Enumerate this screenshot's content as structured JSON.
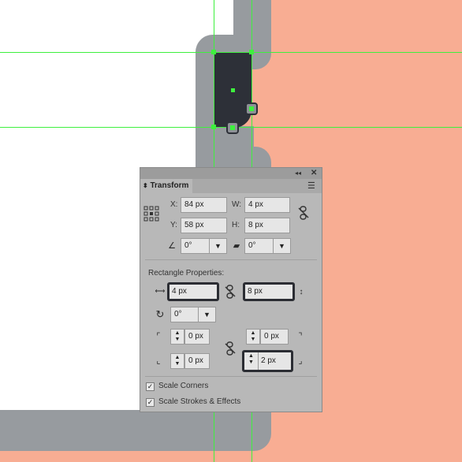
{
  "panel": {
    "title": "Transform",
    "collapse_icon": "double-chevron-left-icon",
    "close_icon": "close-icon",
    "menu_icon": "hamburger-menu-icon",
    "x_label": "X:",
    "x_value": "84 px",
    "y_label": "Y:",
    "y_value": "58 px",
    "w_label": "W:",
    "w_value": "4 px",
    "h_label": "H:",
    "h_value": "8 px",
    "angle_value": "0°",
    "shear_value": "0°",
    "rect_props_title": "Rectangle Properties:",
    "rect_width": "4 px",
    "rect_height": "8 px",
    "rect_rotation": "0°",
    "corner_tl": "0 px",
    "corner_tr": "0 px",
    "corner_bl": "0 px",
    "corner_br": "2 px",
    "scale_corners_label": "Scale Corners",
    "scale_corners_checked": true,
    "scale_strokes_label": "Scale Strokes & Effects",
    "scale_strokes_checked": true
  },
  "colors": {
    "background": "#f8ad93",
    "artboard": "#ffffff",
    "outline": "#979b9f",
    "shape": "#2d3038",
    "guides": "#3ef03e",
    "panel": "#b8b8b8"
  }
}
